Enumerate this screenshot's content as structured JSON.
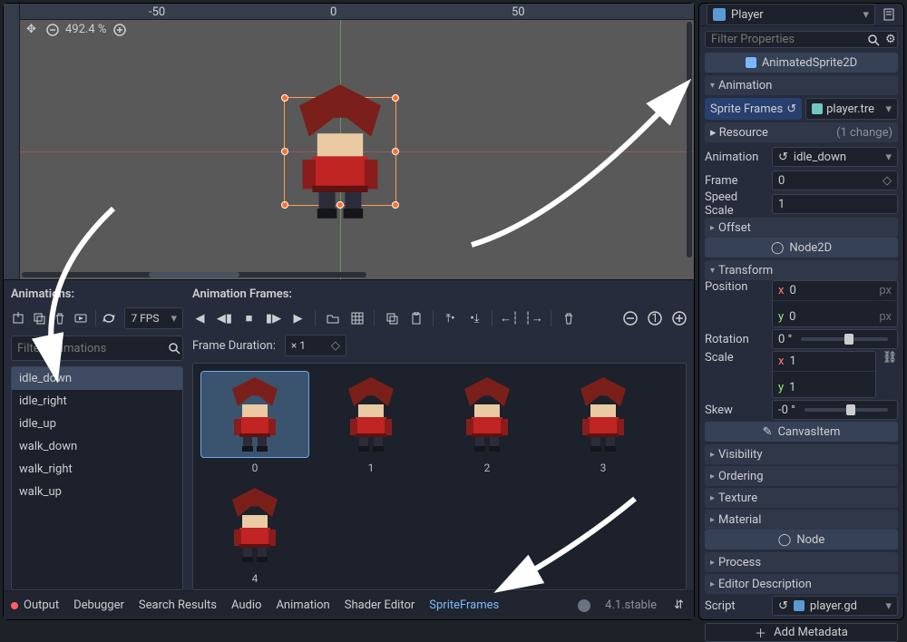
{
  "viewport": {
    "zoom": "492.4 %",
    "ruler_marks": [
      "-50",
      "0",
      "50"
    ]
  },
  "animations_panel": {
    "title": "Animations:",
    "fps": "7 FPS",
    "filter_placeholder": "Filter Animations",
    "frames_title": "Animation Frames:",
    "frame_duration_label": "Frame Duration:",
    "frame_duration_value": "× 1",
    "list": [
      "idle_down",
      "idle_right",
      "idle_up",
      "walk_down",
      "walk_right",
      "walk_up"
    ],
    "selected": "idle_down",
    "frames": [
      "0",
      "1",
      "2",
      "3",
      "4"
    ]
  },
  "bottom_tabs": {
    "items": [
      "Output",
      "Debugger",
      "Search Results",
      "Audio",
      "Animation",
      "Shader Editor",
      "SpriteFrames"
    ],
    "active": "SpriteFrames",
    "version": "4.1.stable"
  },
  "inspector": {
    "node": "Player",
    "filter_placeholder": "Filter Properties",
    "class_chip": "AnimatedSprite2D",
    "categories": {
      "animation": "Animation",
      "offset": "Offset",
      "transform": "Transform",
      "visibility": "Visibility",
      "ordering": "Ordering",
      "texture": "Texture",
      "material": "Material",
      "process": "Process",
      "editor_desc": "Editor Description"
    },
    "sprite_frames_label": "Sprite Frames",
    "sprite_frames_value": "player.tre",
    "resource_label": "Resource",
    "resource_changes": "(1 change)",
    "anim_prop_label": "Animation",
    "anim_prop_value": "idle_down",
    "frame_label": "Frame",
    "frame_value": "0",
    "speed_label": "Speed Scale",
    "speed_value": "1",
    "node2d_chip": "Node2D",
    "position_label": "Position",
    "pos_x": "0",
    "pos_y": "0",
    "pos_unit": "px",
    "rotation_label": "Rotation",
    "rotation_value": "0 °",
    "scale_label": "Scale",
    "scale_x": "1",
    "scale_y": "1",
    "skew_label": "Skew",
    "skew_value": "-0 °",
    "canvasitem_chip": "CanvasItem",
    "node_chip": "Node",
    "script_label": "Script",
    "script_value": "player.gd",
    "add_metadata": "Add Metadata"
  }
}
